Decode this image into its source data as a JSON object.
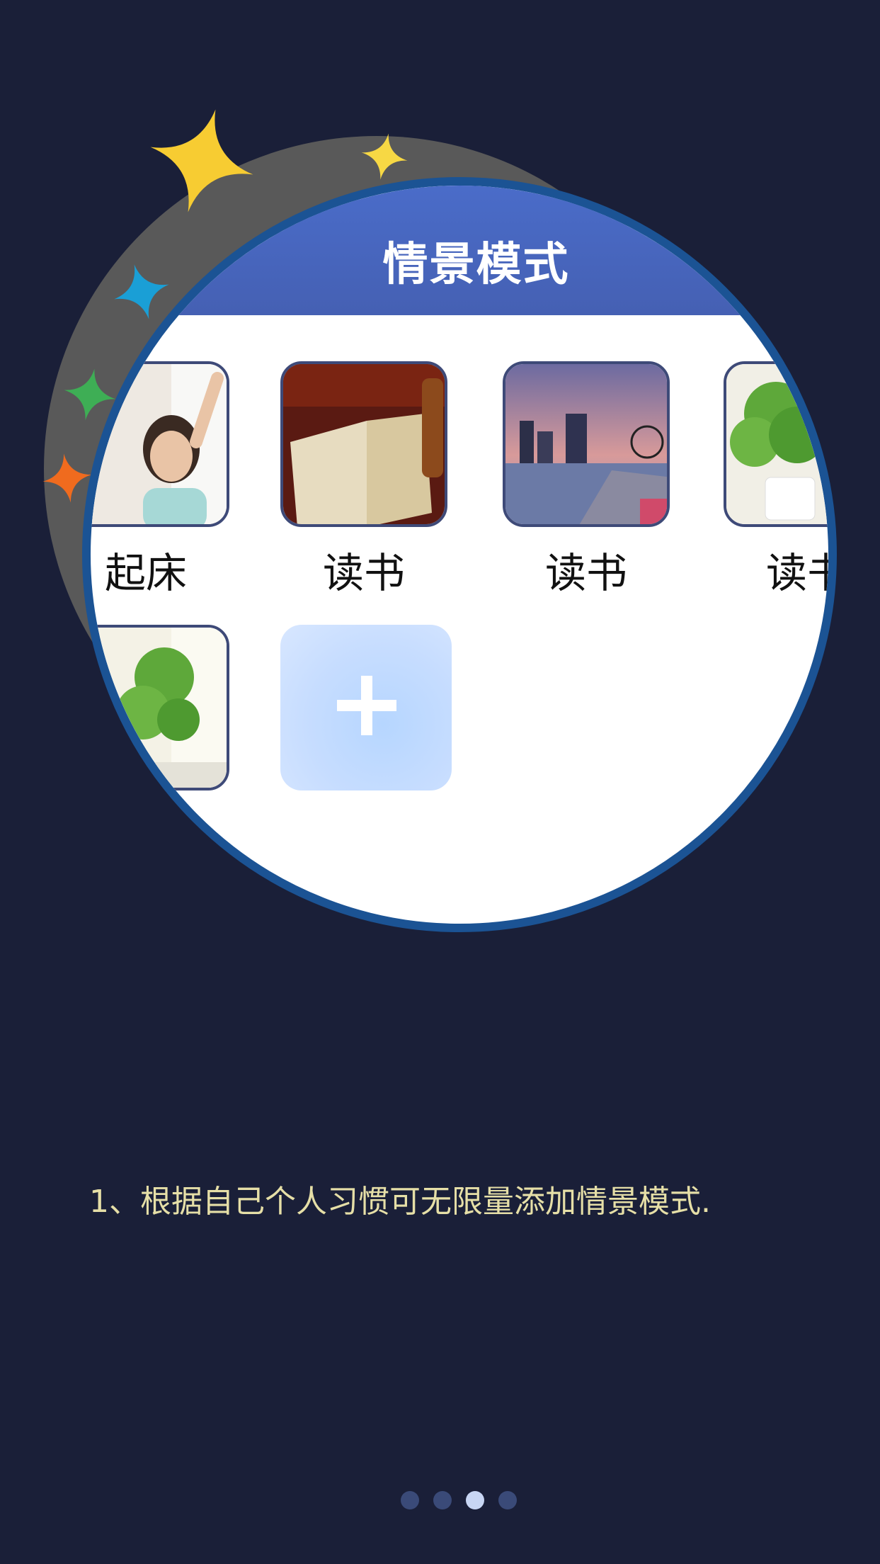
{
  "header": {
    "title": "情景模式"
  },
  "scenes": [
    {
      "label": "起床",
      "image": "woman-waking-up"
    },
    {
      "label": "读书",
      "image": "open-book"
    },
    {
      "label": "读书",
      "image": "city-waterfront-dusk"
    },
    {
      "label": "读书",
      "image": "potted-plant"
    },
    {
      "label": "",
      "image": "potted-plant"
    }
  ],
  "add_button": {
    "icon": "plus-icon"
  },
  "caption": "1、根据自己个人习惯可无限量添加情景模式.",
  "pager": {
    "total": 4,
    "active_index": 2
  },
  "colors": {
    "background": "#1a1f38",
    "ring": "#1b5394",
    "header": "#4a6cc9",
    "caption": "#e6dfa7",
    "dot": "#3a4a78",
    "dot_active": "#c8d6f4"
  }
}
